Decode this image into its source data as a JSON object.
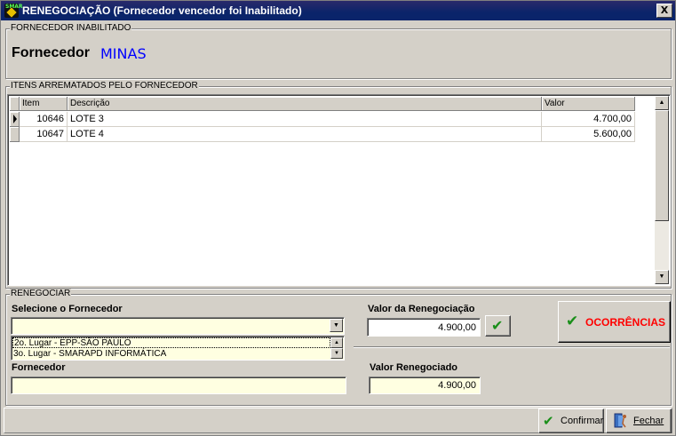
{
  "window": {
    "title": "RENEGOCIAÇÃO (Fornecedor vencedor foi Inabilitado)",
    "icon_text": "SMAR",
    "close_label": "X"
  },
  "fornecedor_inabilitado": {
    "group_label": "FORNECEDOR INABILITADO",
    "label": "Fornecedor",
    "name": "MINAS"
  },
  "itens": {
    "group_label": "ITENS ARREMATADOS PELO FORNECEDOR",
    "columns": [
      "Item",
      "Descrição",
      "Valor"
    ],
    "rows": [
      {
        "item": "10646",
        "descricao": "LOTE 3",
        "valor": "4.700,00"
      },
      {
        "item": "10647",
        "descricao": "LOTE 4",
        "valor": "5.600,00"
      }
    ]
  },
  "renegociar": {
    "group_label": "RENEGOCIAR",
    "select_label": "Selecione o Fornecedor",
    "select_value": "",
    "list_options": [
      "2o. Lugar - EPP-SÃO PAULO",
      "3o. Lugar - SMARAPD INFORMÁTICA"
    ],
    "valor_label": "Valor da Renegociação",
    "valor_value": "4.900,00",
    "ocorrencias_label": "OCORRÊNCIAS",
    "fornecedor_label": "Fornecedor",
    "fornecedor_value": "",
    "valor_renegociado_label": "Valor Renegociado",
    "valor_renegociado_value": "4.900,00"
  },
  "footer": {
    "confirmar_label": "Confirmar",
    "fechar_label": "Fechar"
  },
  "colors": {
    "title_bar": "#0a246a",
    "vendor_name": "#0000ff",
    "ocorrencias_text": "#ff0000",
    "field_background": "#ffffe1",
    "check_icon": "#1a8f1a"
  }
}
